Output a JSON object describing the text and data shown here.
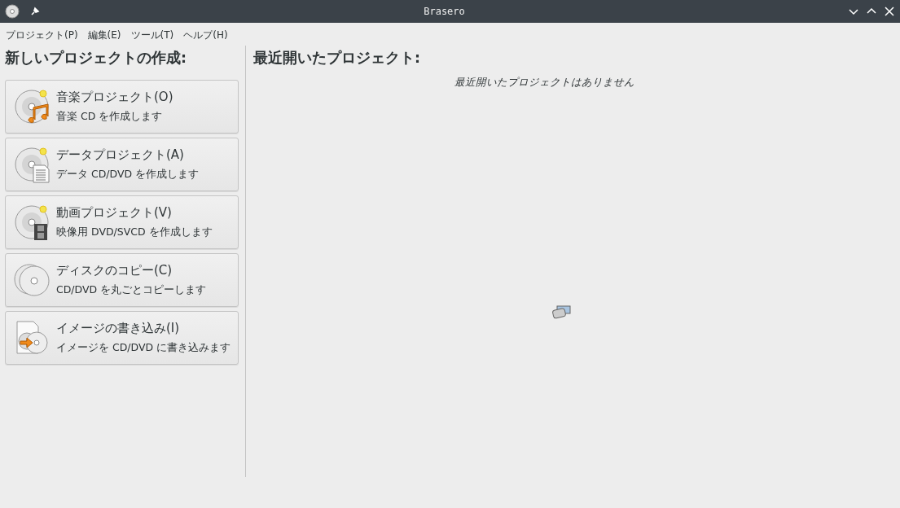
{
  "window": {
    "title": "Brasero"
  },
  "menu": [
    "プロジェクト(P)",
    "編集(E)",
    "ツール(T)",
    "ヘルプ(H)"
  ],
  "new_project": {
    "heading": "新しいプロジェクトの作成:",
    "buttons": [
      {
        "kind": "audio",
        "title": "音楽プロジェクト(O)",
        "description": "音楽 CD を作成します"
      },
      {
        "kind": "data",
        "title": "データプロジェクト(A)",
        "description": "データ CD/DVD を作成します"
      },
      {
        "kind": "video",
        "title": "動画プロジェクト(V)",
        "description": "映像用 DVD/SVCD を作成します"
      },
      {
        "kind": "copy",
        "title": "ディスクのコピー(C)",
        "description": "CD/DVD を丸ごとコピーします"
      },
      {
        "kind": "image",
        "title": "イメージの書き込み(I)",
        "description": "イメージを CD/DVD に書き込みます"
      }
    ]
  },
  "recent": {
    "heading": "最近開いたプロジェクト:",
    "empty_message": "最近開いたプロジェクトはありません"
  }
}
